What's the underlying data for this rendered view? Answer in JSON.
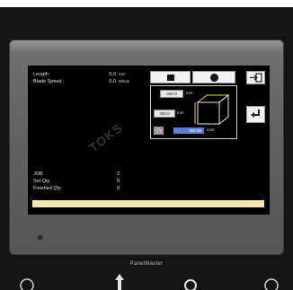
{
  "readout": {
    "length_label": "Length",
    "length_value": "0.0",
    "length_unit": "mm",
    "speed_label": "Blade Speed",
    "speed_value": "0.0",
    "speed_unit": "M/min"
  },
  "dimensions": {
    "width_value": "300.0",
    "width_unit": "mm",
    "height_value": "300.0",
    "height_unit": "mm",
    "area_value": "900.00",
    "area_unit": "cm2"
  },
  "counters": {
    "job_label": "JOB",
    "job_value": "2",
    "set_label": "Set Qty",
    "set_value": "0",
    "finished_label": "Finished Qty",
    "finished_value": "0"
  },
  "device": {
    "brand": "PanelMaster"
  },
  "watermark": {
    "text": "TOKS"
  },
  "icons": {
    "shape_square": "square-shape-icon",
    "shape_circle": "circle-shape-icon",
    "exit": "exit-icon",
    "enter": "enter-arrow-icon",
    "material": "material-swatch-icon",
    "cube": "cube-dimension-icon"
  },
  "colors": {
    "screen_bg": "#000000",
    "area_field": "#5b7fd6",
    "status_bar": "#f3e7b0",
    "bezel": "#606060"
  }
}
